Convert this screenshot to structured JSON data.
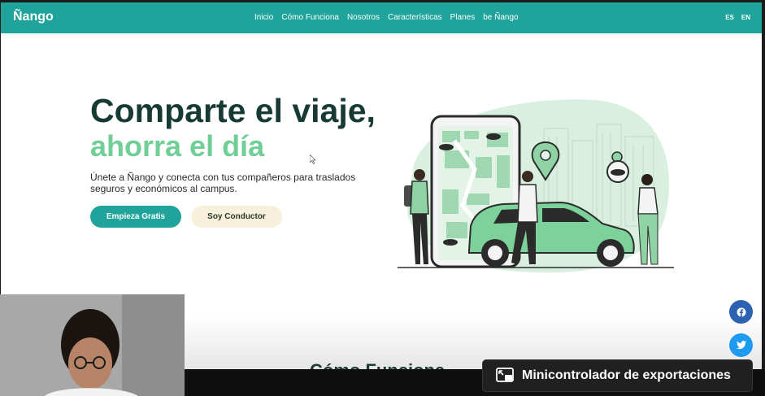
{
  "navbar": {
    "logo": "Ñango",
    "links": [
      "Inicio",
      "Cómo Funciona",
      "Nosotros",
      "Características",
      "Planes",
      "be Ñango"
    ],
    "languages": [
      "ES",
      "EN"
    ]
  },
  "hero": {
    "title_line1": "Comparte el viaje,",
    "title_line2": "ahorra el día",
    "description": "Únete a Ñango y conecta con tus compañeros para traslados seguros y económicos al campus.",
    "primary_button": "Empieza Gratis",
    "secondary_button": "Soy Conductor"
  },
  "next_section": {
    "title": "Cómo Funciona"
  },
  "social": [
    "facebook-icon",
    "twitter-icon"
  ],
  "overlay": {
    "mini_controller_label": "Minicontrolador de exportaciones"
  },
  "colors": {
    "brand_teal": "#1fa39b",
    "title_dark": "#173a35",
    "accent_green": "#6fcf97",
    "secondary_button_bg": "#f7f1dc",
    "facebook_blue": "#2d61b1",
    "twitter_blue": "#1d9bf0"
  }
}
